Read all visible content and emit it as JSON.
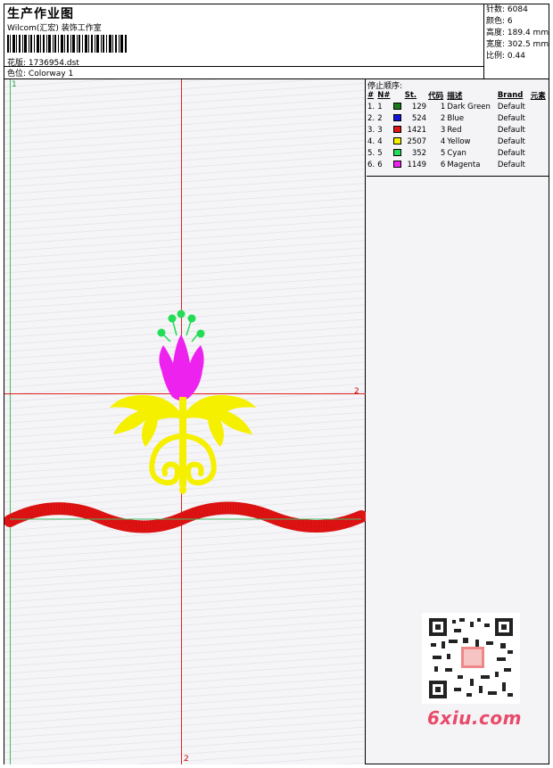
{
  "header": {
    "title": "生产作业图",
    "company": "Wilcom(汇宏) 装饰工作室",
    "design_label": "花版:",
    "design_file": "1736954.dst",
    "colorway_label": "色位:",
    "colorway": "Colorway 1"
  },
  "stats": [
    {
      "label": "针数:",
      "value": "6084"
    },
    {
      "label": "颜色:",
      "value": "6"
    },
    {
      "label": "高度:",
      "value": "189.4 mm"
    },
    {
      "label": "宽度:",
      "value": "302.5 mm"
    },
    {
      "label": "比例:",
      "value": "0.44"
    }
  ],
  "canvas": {
    "label_top_left": "1",
    "label_right": "2",
    "label_bottom": "2"
  },
  "stop_sequence": {
    "title": "停止顺序:",
    "columns": [
      "#",
      "N#",
      "St.",
      "代码",
      "描述",
      "Brand",
      "元素"
    ],
    "rows": [
      {
        "seq": "1.",
        "n": "1",
        "color": "#1a7a1a",
        "stitches": "129",
        "code": "1",
        "desc": "Dark Green",
        "brand": "Default"
      },
      {
        "seq": "2.",
        "n": "2",
        "color": "#1414d8",
        "stitches": "524",
        "code": "2",
        "desc": "Blue",
        "brand": "Default"
      },
      {
        "seq": "3.",
        "n": "3",
        "color": "#e01414",
        "stitches": "1421",
        "code": "3",
        "desc": "Red",
        "brand": "Default"
      },
      {
        "seq": "4.",
        "n": "4",
        "color": "#f5f000",
        "stitches": "2507",
        "code": "4",
        "desc": "Yellow",
        "brand": "Default"
      },
      {
        "seq": "5.",
        "n": "5",
        "color": "#22dd55",
        "stitches": "352",
        "code": "5",
        "desc": "Cyan",
        "brand": "Default"
      },
      {
        "seq": "6.",
        "n": "6",
        "color": "#ee22ee",
        "stitches": "1149",
        "code": "6",
        "desc": "Magenta",
        "brand": "Default"
      }
    ]
  },
  "watermark": {
    "site": "6xiu.com"
  },
  "colors": {
    "guide_red": "#e02020",
    "guide_green": "#44bb66",
    "yellow_motif": "#f5f000",
    "magenta_flower": "#ee22ee",
    "green_dots": "#22dd55",
    "red_wave": "#e01414"
  }
}
